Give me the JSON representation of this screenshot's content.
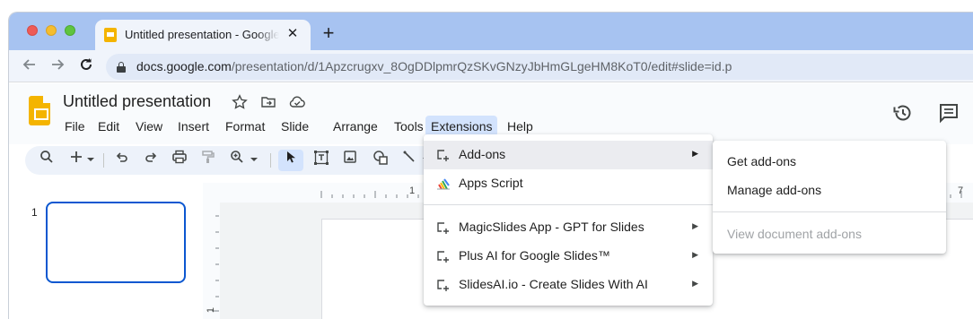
{
  "browser": {
    "tab_title": "Untitled presentation - Google Slides",
    "tab_close": "✕",
    "new_tab": "+",
    "url_host": "docs.google.com",
    "url_path": "/presentation/d/1Apzcrugxv_8OgDDlpmrQzSKvGNzyJbHmGLgeHM8KoT0/edit#slide=id.p"
  },
  "doc": {
    "title": "Untitled presentation"
  },
  "menubar": {
    "items": [
      "File",
      "Edit",
      "View",
      "Insert",
      "Format",
      "Slide",
      "Arrange",
      "Tools",
      "Extensions",
      "Help"
    ],
    "active": "Extensions"
  },
  "filmstrip": {
    "slide_number": "1"
  },
  "ruler": {
    "h_label_1": "1",
    "h_label_7": "7",
    "v_label_1": "1"
  },
  "extensions_menu": {
    "items": [
      {
        "label": "Add-ons",
        "icon": "addon-icon",
        "has_submenu": true
      },
      {
        "label": "Apps Script",
        "icon": "apps-script-icon",
        "has_submenu": false
      },
      {
        "label": "MagicSlides App - GPT for Slides",
        "icon": "addon-icon",
        "has_submenu": true
      },
      {
        "label": "Plus AI for Google Slides™",
        "icon": "addon-icon",
        "has_submenu": true
      },
      {
        "label": "SlidesAI.io - Create Slides With AI",
        "icon": "addon-icon",
        "has_submenu": true
      }
    ],
    "arrow": "▶"
  },
  "addons_submenu": {
    "get": "Get add-ons",
    "manage": "Manage add-ons",
    "view_document": "View document add-ons"
  },
  "colors": {
    "tabbar": "#a7c3f1",
    "accent": "#0b57d0",
    "slides_yellow": "#f4b400",
    "menu_active": "#d3e3fd"
  }
}
